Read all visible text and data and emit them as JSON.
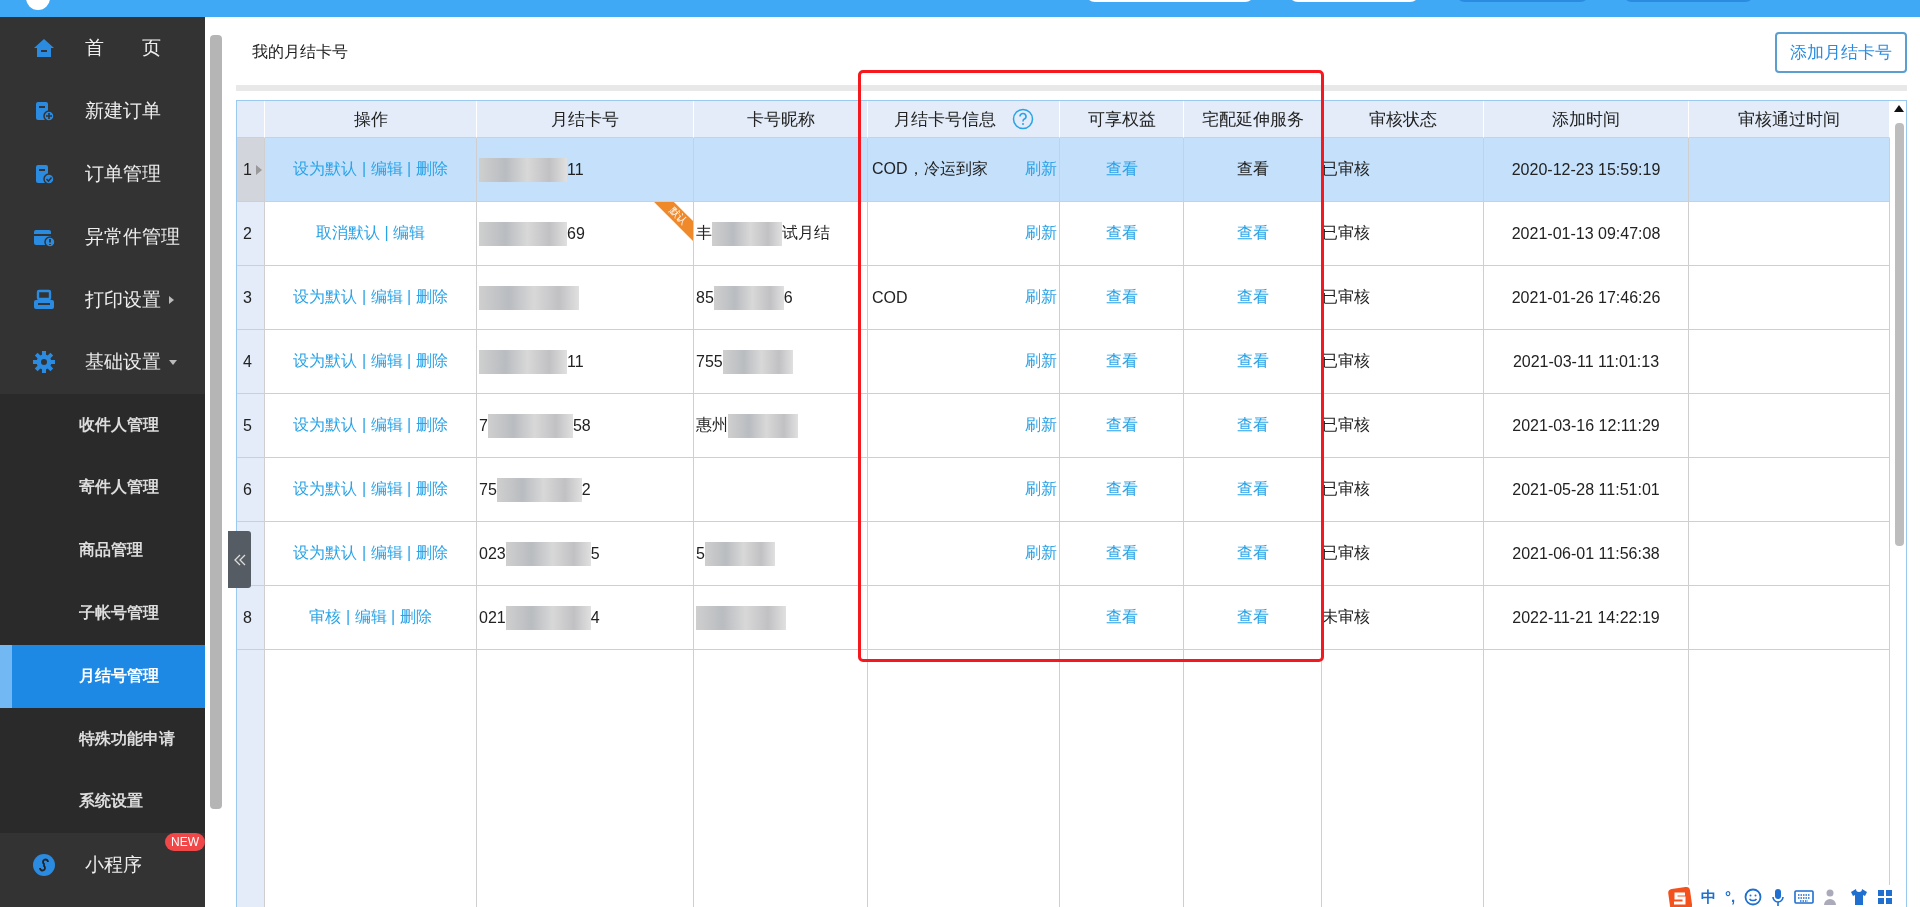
{
  "sidebar": {
    "items": [
      {
        "label": "首　　页",
        "selected": false
      },
      {
        "label": "新建订单",
        "selected": false
      },
      {
        "label": "订单管理",
        "selected": false
      },
      {
        "label": "异常件管理",
        "selected": false
      },
      {
        "label": "打印设置",
        "selected": false,
        "expanded": false
      },
      {
        "label": "基础设置",
        "selected": false,
        "expanded": true,
        "children": [
          {
            "label": "收件人管理",
            "selected": false
          },
          {
            "label": "寄件人管理",
            "selected": false
          },
          {
            "label": "商品管理",
            "selected": false
          },
          {
            "label": "子帐号管理",
            "selected": false
          },
          {
            "label": "月结号管理",
            "selected": true
          },
          {
            "label": "特殊功能申请",
            "selected": false
          },
          {
            "label": "系统设置",
            "selected": false
          }
        ]
      },
      {
        "label": "小程序",
        "selected": false,
        "badge": "NEW"
      }
    ]
  },
  "page": {
    "title": "我的月结卡号",
    "add_button": "添加月结卡号"
  },
  "table": {
    "columns": [
      {
        "label": "操作",
        "help": false
      },
      {
        "label": "月结卡号",
        "help": false
      },
      {
        "label": "卡号昵称",
        "help": false
      },
      {
        "label": "月结卡号信息",
        "help": true
      },
      {
        "label": "可享权益",
        "help": false
      },
      {
        "label": "宅配延伸服务",
        "help": false
      },
      {
        "label": "审核状态",
        "help": false
      },
      {
        "label": "添加时间",
        "help": false
      },
      {
        "label": "审核通过时间",
        "help": false
      }
    ],
    "rows": [
      {
        "index": "1",
        "selected": true,
        "ops": "设为默认 | 编辑 | 删除",
        "card": {
          "tail": "11"
        },
        "info": "COD，冷运到家",
        "refresh": "刷新",
        "benefits": "查看",
        "service": {
          "text": "查看",
          "link": false
        },
        "status": "已审核",
        "added": "2020-12-23 15:59:19"
      },
      {
        "index": "2",
        "selected": false,
        "ops": "取消默认 | 编辑",
        "card": {
          "tail": "69"
        },
        "tag": "默认",
        "nick": {
          "head": "丰",
          "tail": "试月结"
        },
        "refresh": "刷新",
        "benefits": "查看",
        "service": {
          "text": "查看",
          "link": true
        },
        "status": "已审核",
        "added": "2021-01-13 09:47:08"
      },
      {
        "index": "3",
        "selected": false,
        "ops": "设为默认 | 编辑 | 删除",
        "card": {},
        "nick": {
          "head": "85",
          "tail": "6"
        },
        "info": "COD",
        "refresh": "刷新",
        "benefits": "查看",
        "service": {
          "text": "查看",
          "link": true
        },
        "status": "已审核",
        "added": "2021-01-26 17:46:26"
      },
      {
        "index": "4",
        "selected": false,
        "ops": "设为默认 | 编辑 | 删除",
        "card": {
          "tail": "11"
        },
        "nick": {
          "head": "755"
        },
        "refresh": "刷新",
        "benefits": "查看",
        "service": {
          "text": "查看",
          "link": true
        },
        "status": "已审核",
        "added": "2021-03-11 11:01:13"
      },
      {
        "index": "5",
        "selected": false,
        "ops": "设为默认 | 编辑 | 删除",
        "card": {
          "head": "7",
          "tail": "58"
        },
        "nick": {
          "head": "惠州"
        },
        "refresh": "刷新",
        "benefits": "查看",
        "service": {
          "text": "查看",
          "link": true
        },
        "status": "已审核",
        "added": "2021-03-16 12:11:29"
      },
      {
        "index": "6",
        "selected": false,
        "ops": "设为默认 | 编辑 | 删除",
        "card": {
          "head": "75",
          "tail": "2"
        },
        "refresh": "刷新",
        "benefits": "查看",
        "service": {
          "text": "查看",
          "link": true
        },
        "status": "已审核",
        "added": "2021-05-28 11:51:01"
      },
      {
        "selected": false,
        "ops": "设为默认 | 编辑 | 删除",
        "card": {
          "head": "023",
          "tail": "5"
        },
        "nick": {
          "head": "5"
        },
        "refresh": "刷新",
        "benefits": "查看",
        "service": {
          "text": "查看",
          "link": true
        },
        "status": "已审核",
        "added": "2021-06-01 11:56:38"
      },
      {
        "index": "8",
        "selected": false,
        "ops": "审核 | 编辑 | 删除",
        "card": {
          "head": "021",
          "tail": "4"
        },
        "nick": {},
        "benefits": "查看",
        "service": {
          "text": "查看",
          "link": true
        },
        "status": "未审核",
        "added": "2022-11-21 14:22:19"
      }
    ]
  },
  "ime": {
    "mode": "中",
    "punct": "°,"
  }
}
